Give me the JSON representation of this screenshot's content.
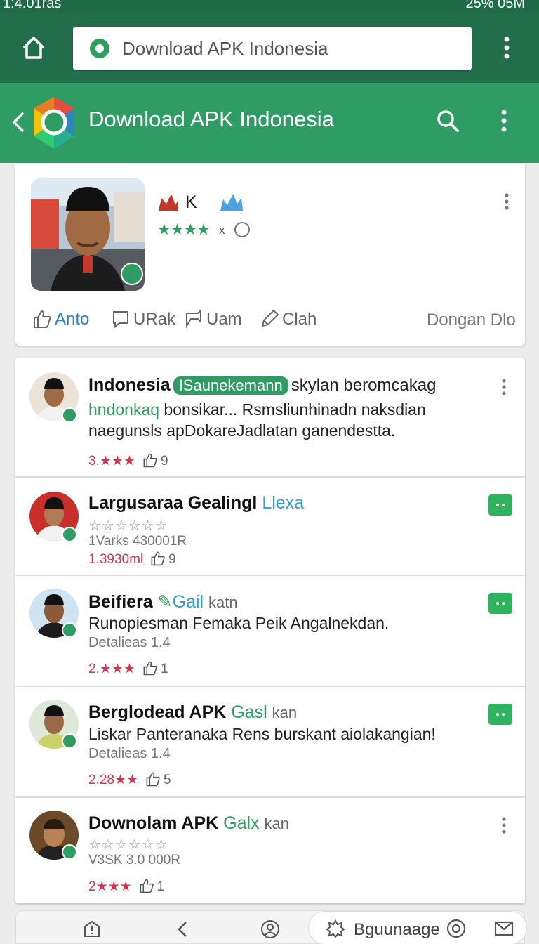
{
  "status_bar": {
    "left_text": "1:4.01ras",
    "right_text": "25%  05M"
  },
  "browser": {
    "url_text": "Download APK Indonesia"
  },
  "app_bar": {
    "title": "Download APK Indonesia"
  },
  "app_card": {
    "letter": "K",
    "stars": "★★★★",
    "rating_suffix": "x",
    "actions": [
      {
        "label": "Anto",
        "icon": "thumbs-up-icon",
        "active": true
      },
      {
        "label": "URak",
        "icon": "comment-icon",
        "active": false
      },
      {
        "label": "Uam",
        "icon": "share-icon",
        "active": false
      },
      {
        "label": "Clah",
        "icon": "pencil-icon",
        "active": false
      }
    ],
    "secondary_action": "Dongan Dlo"
  },
  "reviews": [
    {
      "name": "Indonesia",
      "tag": "ISaunekemann",
      "title_rest": "skylan beromcakag",
      "line1_green": "hndonkaq",
      "line1_rest": " bonsikar...  Rsmsliunhinadn naksdian",
      "line2": "naegunsls apDokareJadlatan ganendestta.",
      "score": "3.★★★",
      "likes": "9",
      "action": "menu"
    },
    {
      "name": "Largusaraa Gealingl",
      "accent": "Llexa",
      "stars_empty": "☆☆☆☆☆☆",
      "meta": "1Varks 430001R",
      "score": "1.3930ml",
      "likes": "9",
      "action": "chat"
    },
    {
      "name": "Beifiera",
      "accent": "Gail",
      "muted": "katn",
      "body": "Runopiesman Femaka Peik Angalnekdan.",
      "meta": "Detalieas 1.4",
      "score": "2.★★★",
      "likes": "1",
      "action": "chat"
    },
    {
      "name": "Berglodead APK",
      "accent_green": "Gasl",
      "muted": "kan",
      "body": "Liskar Panteranaka Rens burskant aiolakangian!",
      "meta": "Detalieas 1.4",
      "score": "2.28★★",
      "likes": "5",
      "action": "chat"
    },
    {
      "name": "Downolam APK",
      "accent_green": "Galx",
      "muted": "kan",
      "stars_empty": "☆☆☆☆☆☆",
      "meta": "V3SK 3.0 000R",
      "score": "2★★★",
      "likes": "1",
      "action": "menu"
    }
  ],
  "bottom_bar": {
    "pill_label": "Bguunaage"
  },
  "colors": {
    "primary": "#2f9d63",
    "primary_dark": "#226e4b",
    "accent_blue": "#2e86b8",
    "score_red": "#d2364f"
  }
}
